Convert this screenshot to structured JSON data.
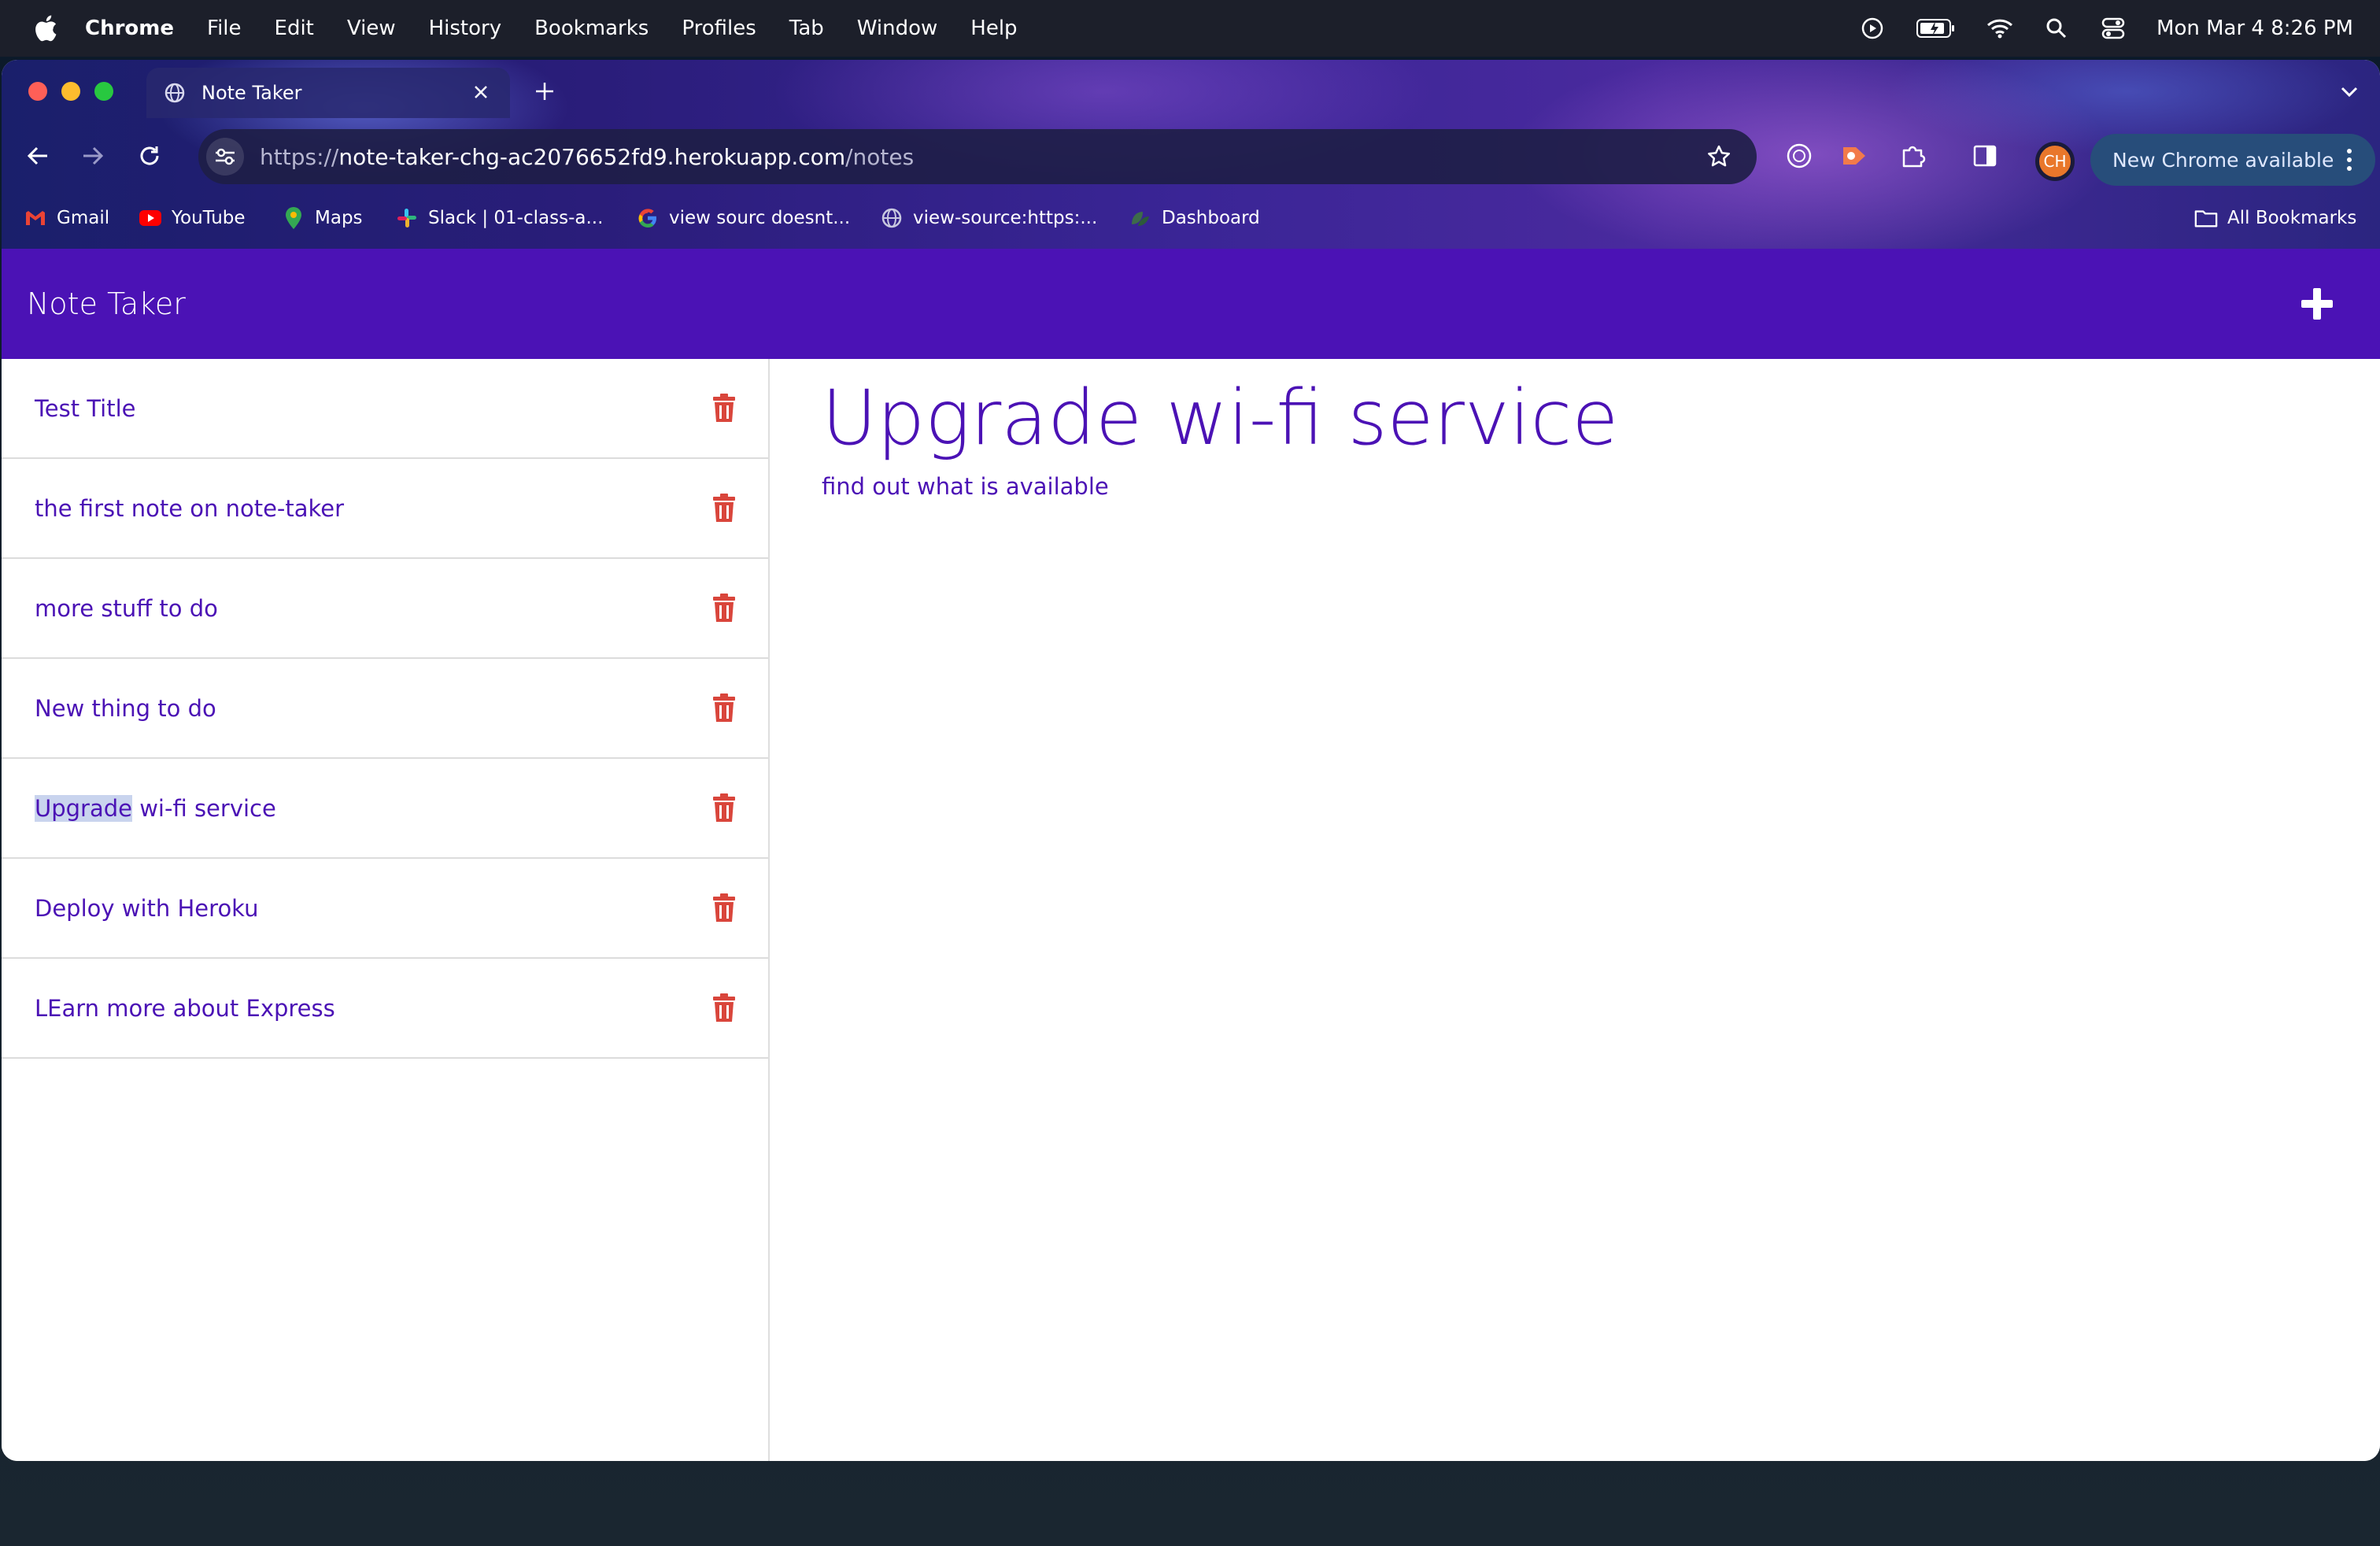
{
  "menubar": {
    "app": "Chrome",
    "items": [
      "File",
      "Edit",
      "View",
      "History",
      "Bookmarks",
      "Profiles",
      "Tab",
      "Window",
      "Help"
    ],
    "clock": "Mon Mar 4  8:26 PM"
  },
  "browser": {
    "tab_title": "Note Taker",
    "url_scheme": "https://",
    "url_host": "note-taker-chg-ac2076652fd9.herokuapp.com",
    "url_path": "/notes",
    "profile_initials": "CH",
    "update_label": "New Chrome available",
    "bookmarks": [
      "Gmail",
      "YouTube",
      "Maps",
      "Slack | 01-class-a...",
      "view sourc doesnt...",
      "view-source:https:...",
      "Dashboard"
    ],
    "all_bookmarks": "All Bookmarks"
  },
  "app": {
    "title": "Note Taker",
    "notes": [
      {
        "title": "Test Title"
      },
      {
        "title": "the first note on note-taker"
      },
      {
        "title": "more stuff to do"
      },
      {
        "title": "New thing to do"
      },
      {
        "title_selected_part": "Upgrade",
        "title_rest": " wi-fi service"
      },
      {
        "title": "Deploy with Heroku"
      },
      {
        "title": "LEarn more about Express"
      }
    ],
    "active_note": {
      "title": "Upgrade wi-fi service",
      "text": "find out what is available"
    }
  },
  "colors": {
    "brand": "#4b12b5",
    "trash": "#d9453b",
    "selection": "#c9d4ee"
  }
}
